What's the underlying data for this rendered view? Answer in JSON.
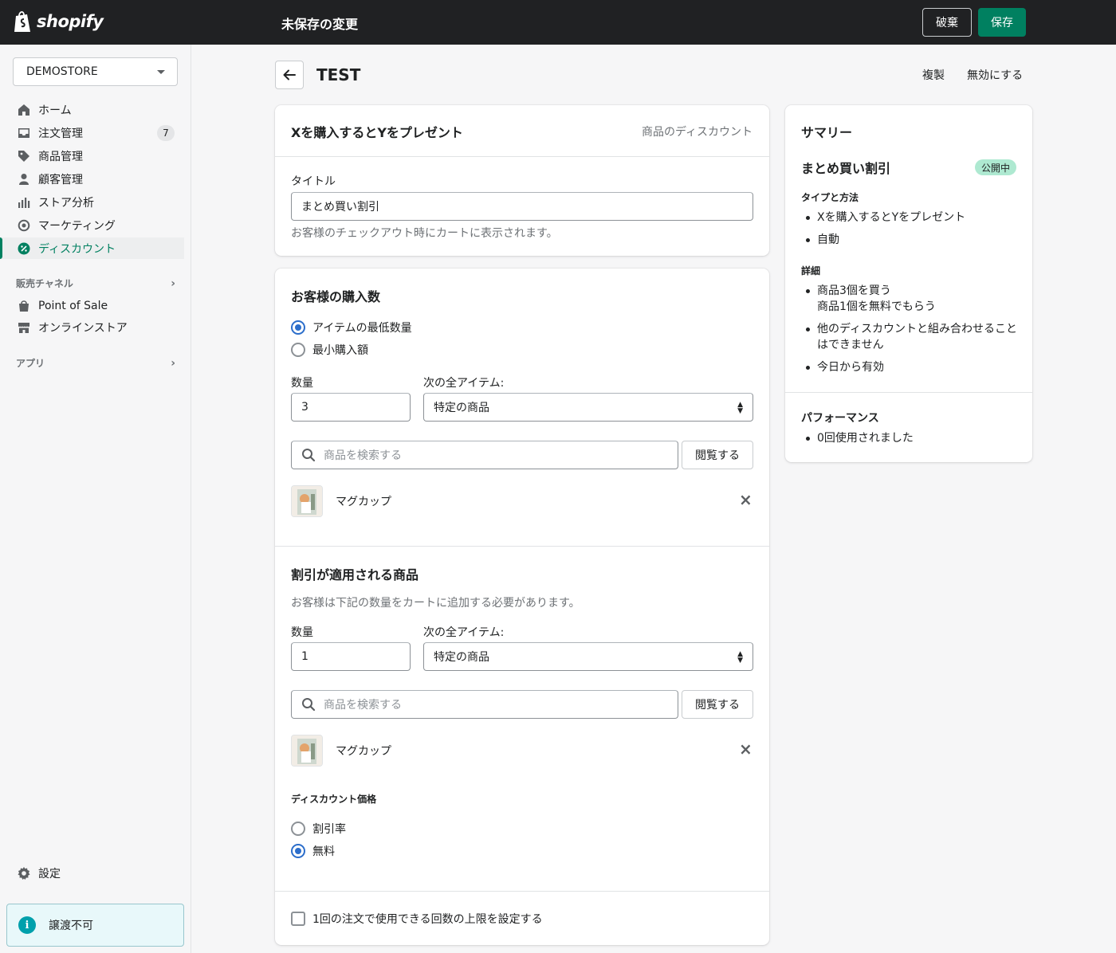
{
  "topbar": {
    "logo_text": "shopify",
    "title": "未保存の変更",
    "discard_label": "破棄",
    "save_label": "保存"
  },
  "sidebar": {
    "store_name": "DEMOSTORE",
    "items": [
      {
        "label": "ホーム",
        "icon": "home-icon"
      },
      {
        "label": "注文管理",
        "icon": "inbox-icon",
        "badge": "7"
      },
      {
        "label": "商品管理",
        "icon": "tag-icon"
      },
      {
        "label": "顧客管理",
        "icon": "person-icon"
      },
      {
        "label": "ストア分析",
        "icon": "bar-chart-icon"
      },
      {
        "label": "マーケティング",
        "icon": "target-icon"
      },
      {
        "label": "ディスカウント",
        "icon": "discount-icon",
        "active": true
      }
    ],
    "sales_channels_label": "販売チャネル",
    "channels": [
      {
        "label": "Point of Sale",
        "icon": "pos-bag-icon"
      },
      {
        "label": "オンラインストア",
        "icon": "store-icon"
      }
    ],
    "apps_label": "アプリ",
    "settings_label": "設定",
    "transfer_label": "譲渡不可"
  },
  "page": {
    "title": "TEST",
    "duplicate_label": "複製",
    "disable_label": "無効にする"
  },
  "main": {
    "type_title": "Xを購入するとYをプレゼント",
    "type_subtitle": "商品のディスカウント",
    "title_label": "タイトル",
    "title_value": "まとめ買い割引",
    "title_help": "お客様のチェックアウト時にカートに表示されます。",
    "buys": {
      "heading": "お客様の購入数",
      "radio_min_qty": "アイテムの最低数量",
      "radio_min_amount": "最小購入額",
      "qty_label": "数量",
      "qty_value": "3",
      "any_items_label": "次の全アイテム:",
      "any_items_value": "特定の商品",
      "search_placeholder": "商品を検索する",
      "browse_label": "閲覧する",
      "product_name": "マグカップ"
    },
    "gets": {
      "heading": "割引が適用される商品",
      "help": "お客様は下記の数量をカートに追加する必要があります。",
      "qty_label": "数量",
      "qty_value": "1",
      "any_items_label": "次の全アイテム:",
      "any_items_value": "特定の商品",
      "search_placeholder": "商品を検索する",
      "browse_label": "閲覧する",
      "product_name": "マグカップ",
      "discount_value_heading": "ディスカウント価格",
      "radio_percentage": "割引率",
      "radio_free": "無料"
    },
    "max_uses_label": "1回の注文で使用できる回数の上限を設定する"
  },
  "summary": {
    "heading": "サマリー",
    "discount_name": "まとめ買い割引",
    "status_badge": "公開中",
    "type_heading": "タイプと方法",
    "type_items": [
      "Xを購入するとYをプレゼント",
      "自動"
    ],
    "details_heading": "詳細",
    "details_items": [
      "商品3個を買う",
      "商品1個を無料でもらう",
      "他のディスカウントと組み合わせること",
      "はできません",
      "今日から有効"
    ],
    "performance_heading": "パフォーマンス",
    "performance_items": [
      "0回使用されました"
    ]
  },
  "colors": {
    "topbar_bg": "#202123",
    "primary": "#008060",
    "radio_selected": "#2c6ecb",
    "badge_success": "#aee9d1",
    "info_bg": "#e8f8fa"
  }
}
